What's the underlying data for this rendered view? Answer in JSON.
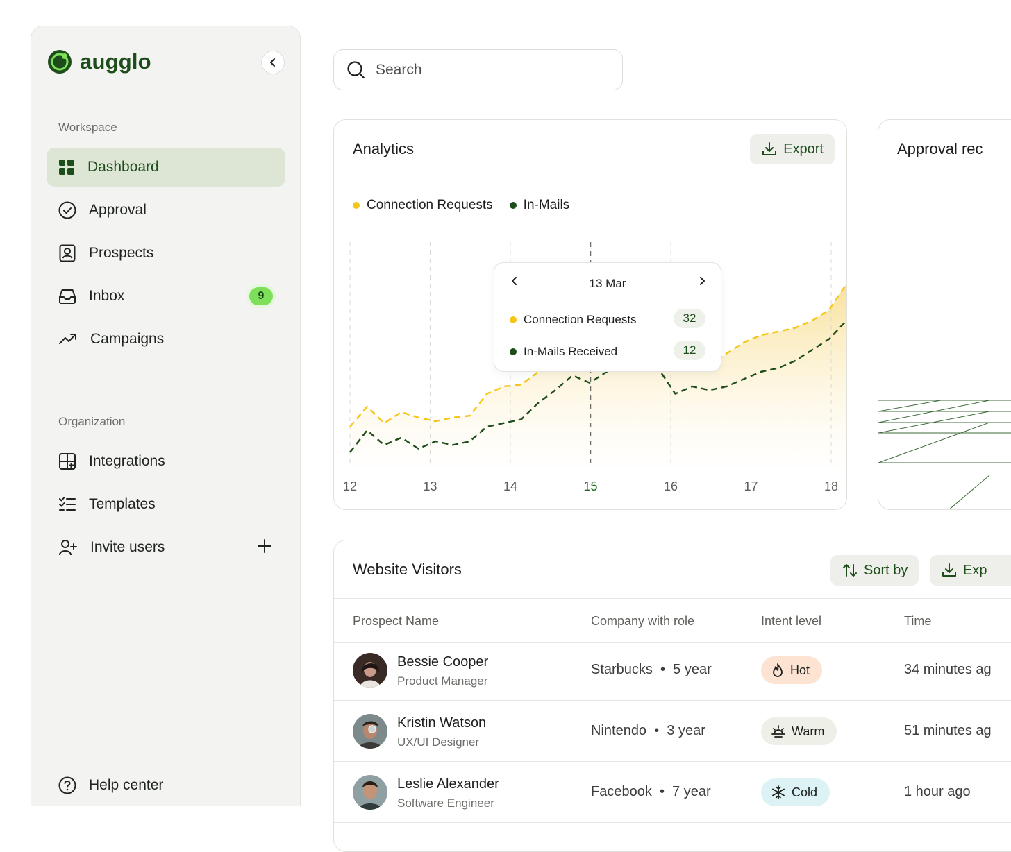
{
  "brand": {
    "name": "augglo"
  },
  "sidebar": {
    "workspace_label": "Workspace",
    "workspace_items": [
      {
        "label": "Dashboard",
        "icon": "grid-icon",
        "active": true
      },
      {
        "label": "Approval",
        "icon": "check-circle-icon"
      },
      {
        "label": "Prospects",
        "icon": "contact-icon"
      },
      {
        "label": "Inbox",
        "icon": "inbox-icon",
        "badge": "9"
      },
      {
        "label": "Campaigns",
        "icon": "trend-icon"
      }
    ],
    "organization_label": "Organization",
    "organization_items": [
      {
        "label": "Integrations",
        "icon": "integrations-icon"
      },
      {
        "label": "Templates",
        "icon": "checklist-icon"
      },
      {
        "label": "Invite users",
        "icon": "user-plus-icon"
      }
    ],
    "help_label": "Help center"
  },
  "search": {
    "placeholder": "Search"
  },
  "analytics": {
    "title": "Analytics",
    "export_label": "Export",
    "tooltip": {
      "date": "13 Mar",
      "rows": [
        {
          "label": "Connection Requests",
          "value": "32"
        },
        {
          "label": "In-Mails Received",
          "value": "12"
        }
      ]
    }
  },
  "chart_data": {
    "type": "area",
    "x": [
      12,
      13,
      14,
      15,
      16,
      17,
      18
    ],
    "highlighted_x": 15,
    "series": [
      {
        "name": "Connection Requests",
        "color": "#f5c518",
        "values": [
          22,
          33,
          24,
          30,
          27,
          25,
          27,
          28,
          40,
          44,
          45,
          52,
          58,
          66,
          72,
          70,
          68,
          62,
          58,
          52,
          54,
          56,
          62,
          68,
          72,
          74,
          76,
          80,
          86,
          100
        ]
      },
      {
        "name": "In-Mails",
        "color": "#1d4d1a",
        "values": [
          8,
          20,
          12,
          16,
          10,
          14,
          12,
          14,
          22,
          24,
          26,
          35,
          42,
          50,
          46,
          52,
          58,
          62,
          54,
          40,
          44,
          42,
          44,
          48,
          52,
          54,
          58,
          64,
          70,
          80
        ]
      }
    ],
    "ylim": [
      0,
      110
    ],
    "legend": "top-left",
    "grid": "vertical-dashed"
  },
  "approval": {
    "title": "Approval rec"
  },
  "visitors": {
    "title": "Website Visitors",
    "sort_label": "Sort by",
    "export_label": "Exp",
    "columns": [
      "Prospect Name",
      "Company with role",
      "Intent level",
      "Time"
    ],
    "rows": [
      {
        "name": "Bessie Cooper",
        "role": "Product Manager",
        "company": "Starbucks",
        "years": "5 year",
        "intent": "Hot",
        "time": "34 minutes ag"
      },
      {
        "name": "Kristin Watson",
        "role": "UX/UI Designer",
        "company": "Nintendo",
        "years": "3 year",
        "intent": "Warm",
        "time": "51 minutes ag"
      },
      {
        "name": "Leslie Alexander",
        "role": "Software Engineer",
        "company": "Facebook",
        "years": "7 year",
        "intent": "Cold",
        "time": "1 hour ago"
      }
    ],
    "intent_colors": {
      "Hot": "#fde3d2",
      "Warm": "#eef0e8",
      "Cold": "#dcf2f5"
    }
  }
}
